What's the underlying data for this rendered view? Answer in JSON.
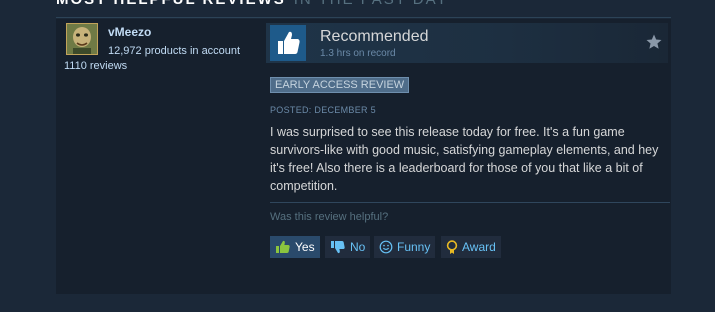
{
  "section": {
    "title": "Most Helpful Reviews",
    "subtitle": "In the past day"
  },
  "review": {
    "author": {
      "name": "vMeezo",
      "products": "12,972 products in account",
      "reviews": "1110 reviews"
    },
    "verdict": "Recommended",
    "hours": "1.3 hrs on record",
    "badge": "EARLY ACCESS REVIEW",
    "posted": "POSTED: DECEMBER 5",
    "text": "I was surprised to see this release today for free. It's a fun game survivors-like with good music, satisfying gameplay elements, and hey it's free! Also there is a leaderboard for those of you that like a bit of competition.",
    "helpful_question": "Was this review helpful?",
    "buttons": {
      "yes": "Yes",
      "no": "No",
      "funny": "Funny",
      "award": "Award"
    }
  },
  "colors": {
    "page_bg": "#1b2838",
    "card_bg": "#16202d",
    "accent_link": "#67c1f5",
    "thumb_bg": "#1e5a8a"
  },
  "icons": {
    "thumb": "thumbs-up-icon",
    "star": "star-icon",
    "yes": "thumbs-up-icon",
    "no": "thumbs-down-icon",
    "funny": "smiley-icon",
    "award": "award-icon"
  }
}
